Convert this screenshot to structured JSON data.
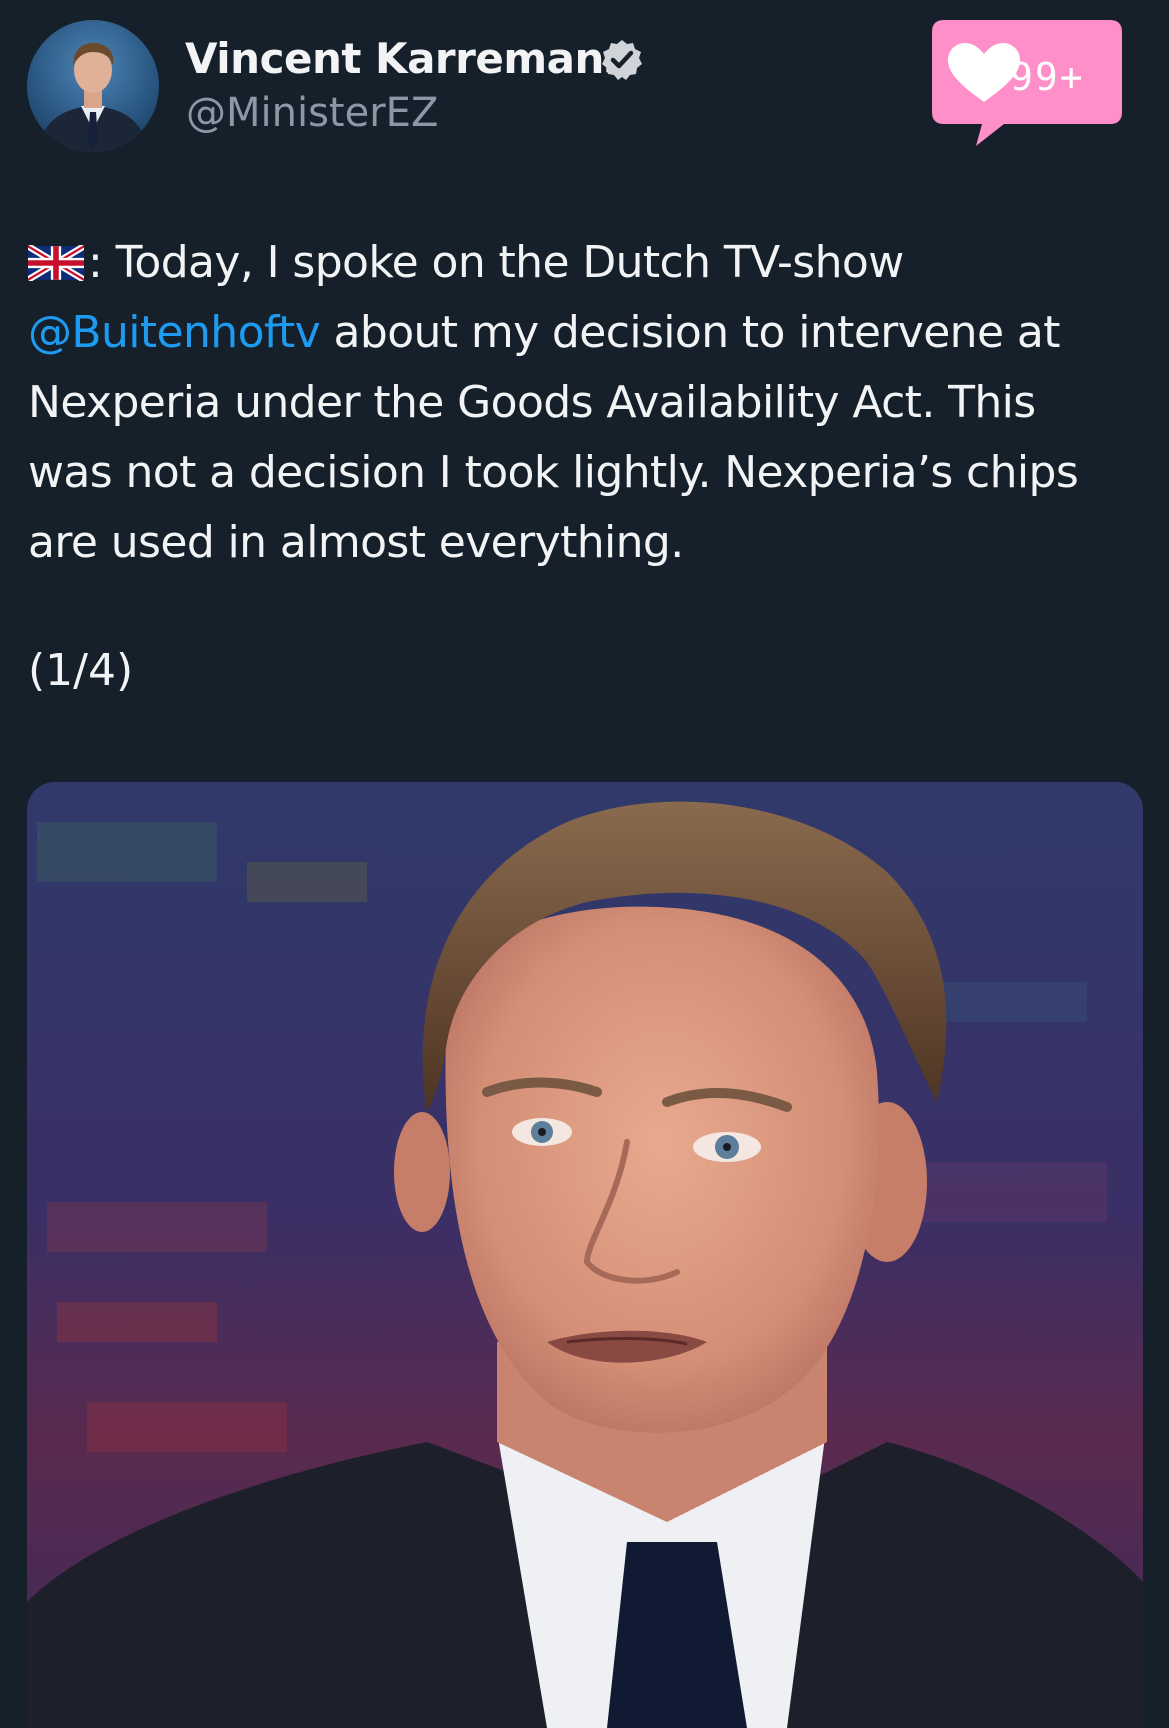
{
  "post": {
    "author": {
      "display_name": "Vincent Karremans",
      "handle": "@MinisterEZ",
      "verified": true,
      "avatar_icon": "profile-photo"
    },
    "notification": {
      "count": "99+",
      "icon": "heart-icon",
      "color": "#ff8fc8"
    },
    "text": {
      "flag_icon": "uk-flag-icon",
      "line1": ": Today, I spoke on the Dutch TV-show",
      "mention": "@Buitenhoftv",
      "line2_rest": " about my decision to intervene at",
      "line3": "Nexperia under the Goods Availability Act. This",
      "line4": "was not a decision I took lightly. Nexperia’s chips",
      "line5": "are used in almost everything."
    },
    "thread_counter": "(1/4)",
    "media": {
      "type": "photo",
      "description_icon": "tv-interview-photo"
    },
    "colors": {
      "background": "#16202b",
      "mention": "#1d9bf0",
      "handle": "#8b98a5"
    }
  }
}
